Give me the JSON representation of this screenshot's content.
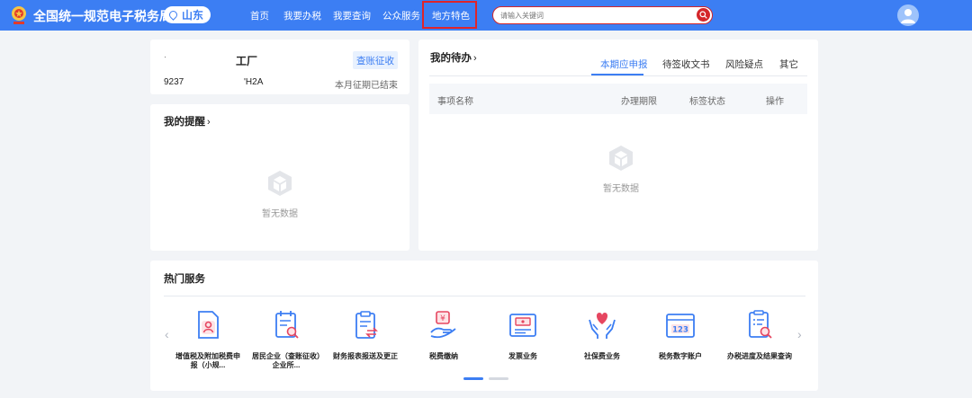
{
  "header": {
    "site_title": "全国统一规范电子税务局",
    "region": "山东",
    "nav": [
      "首页",
      "我要办税",
      "我要查询",
      "公众服务",
      "地方特色"
    ],
    "search_placeholder": "请输入关键词"
  },
  "company": {
    "name_dot": "·",
    "name": "工厂",
    "ledger_button": "查账征收",
    "tax_id_a": "9237",
    "tax_id_b": "'H2A",
    "period_status": "本月征期已结束"
  },
  "reminders": {
    "title": "我的提醒",
    "chevron": "›",
    "empty_text": "暂无数据"
  },
  "todo": {
    "title": "我的待办",
    "chevron": "›",
    "tabs": [
      "本期应申报",
      "待签收文书",
      "风险疑点",
      "其它"
    ],
    "active_tab": 0,
    "columns": [
      "事项名称",
      "办理期限",
      "标签状态",
      "操作"
    ],
    "empty_text": "暂无数据"
  },
  "hot": {
    "title": "热门服务",
    "prev": "‹",
    "next": "›",
    "services": [
      {
        "label": "增值税及附加税费申报（小规...",
        "icon": "person-doc-icon"
      },
      {
        "label": "居民企业（查账征收）企业所...",
        "icon": "calendar-search-icon"
      },
      {
        "label": "财务报表报送及更正",
        "icon": "clipboard-transfer-icon"
      },
      {
        "label": "税费缴纳",
        "icon": "hand-yuan-icon"
      },
      {
        "label": "发票业务",
        "icon": "invoice-icon"
      },
      {
        "label": "社保费业务",
        "icon": "hands-heart-icon"
      },
      {
        "label": "税务数字账户",
        "icon": "account-123-icon"
      },
      {
        "label": "办税进度及结果查询",
        "icon": "list-search-icon"
      }
    ]
  },
  "colors": {
    "primary": "#3c7ef3",
    "highlight": "#e0242a",
    "search_accent": "#d4262a"
  }
}
